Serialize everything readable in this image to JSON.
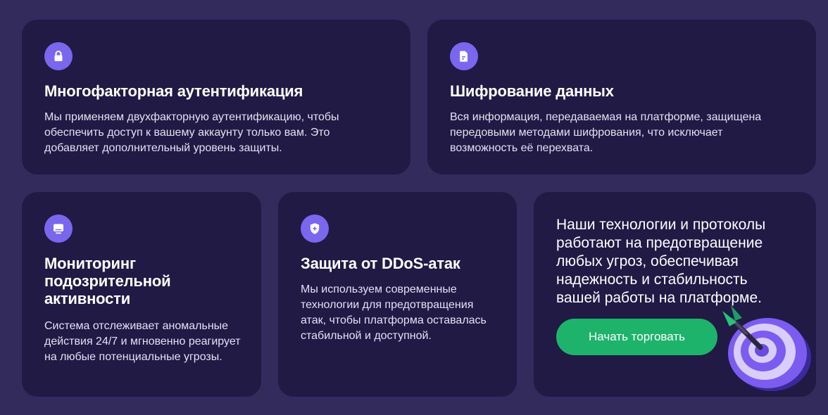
{
  "cards": [
    {
      "icon": "lock-icon",
      "title": "Многофакторная аутентификация",
      "text": "Мы применяем двухфакторную аутентификацию, чтобы обеспечить доступ к вашему аккаунту только вам. Это добавляет дополнительный уровень защиты."
    },
    {
      "icon": "document-icon",
      "title": "Шифрование данных",
      "text": "Вся информация, передаваемая на платформе, защищена передовыми методами шифрования, что исключает возможность её перехвата."
    },
    {
      "icon": "monitor-icon",
      "title": "Мониторинг подозрительной активности",
      "text": "Система отслеживает аномальные действия 24/7 и мгновенно реагирует на любые потенциальные угрозы."
    },
    {
      "icon": "shield-icon",
      "title": "Защита от DDoS-атак",
      "text": "Мы используем современные технологии для предотвращения атак, чтобы платформа оставалась стабильной и доступной."
    }
  ],
  "promo": {
    "text": "Наши технологии и протоколы работают на предотвращение любых угроз, обеспечивая надежность и стабильность вашей работы на платформе.",
    "button_label": "Начать торговать",
    "illustration": "dart-target-icon"
  },
  "colors": {
    "background": "#332b5c",
    "card": "#201a45",
    "icon_accent": "#7a67ee",
    "button": "#1db36b"
  }
}
